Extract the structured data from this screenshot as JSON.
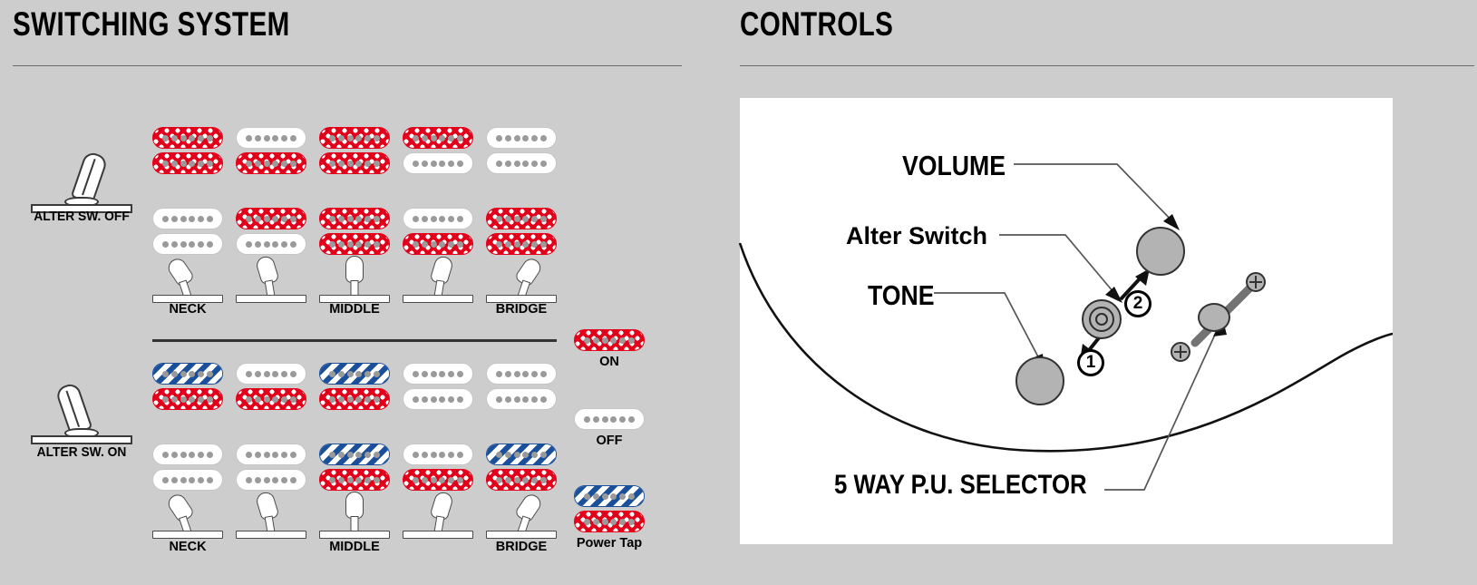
{
  "panels": {
    "switching": {
      "title": "SWITCHING SYSTEM"
    },
    "controls": {
      "title": "CONTROLS"
    }
  },
  "switching": {
    "alter_off_label": "ALTER SW. OFF",
    "alter_on_label": "ALTER SW. ON",
    "position_labels": [
      "NECK",
      "",
      "MIDDLE",
      "",
      "BRIDGE"
    ],
    "legend": [
      {
        "label": "ON",
        "state": "on"
      },
      {
        "label": "OFF",
        "state": "off"
      },
      {
        "label": "Power Tap",
        "state": "tap"
      }
    ],
    "alter_off_matrix": {
      "row_top": [
        [
          "on",
          "on"
        ],
        [
          "off",
          "on"
        ],
        [
          "on",
          "on"
        ],
        [
          "on",
          "off"
        ],
        [
          "off",
          "off"
        ]
      ],
      "row_bottom": [
        [
          "off",
          "off"
        ],
        [
          "on",
          "off"
        ],
        [
          "on",
          "on"
        ],
        [
          "off",
          "on"
        ],
        [
          "on",
          "on"
        ]
      ]
    },
    "alter_on_matrix": {
      "row_top": [
        [
          "tap",
          "on"
        ],
        [
          "off",
          "on"
        ],
        [
          "tap",
          "on"
        ],
        [
          "off",
          "off"
        ],
        [
          "off",
          "off"
        ]
      ],
      "row_bottom": [
        [
          "off",
          "off"
        ],
        [
          "off",
          "off"
        ],
        [
          "tap",
          "on"
        ],
        [
          "off",
          "on"
        ],
        [
          "tap",
          "on"
        ]
      ]
    }
  },
  "controls": {
    "labels": {
      "volume": "VOLUME",
      "alter_switch": "Alter Switch",
      "tone": "TONE",
      "selector": "5 WAY P.U. SELECTOR"
    },
    "callout_numbers": [
      "1",
      "2"
    ]
  },
  "colors": {
    "background": "#cdcdcd",
    "on_red": "#e2001a",
    "tap_blue": "#1a4f9c",
    "knob_gray": "#b3b3b3",
    "rule_gray": "#6d6d6d",
    "board_white": "#ffffff"
  }
}
